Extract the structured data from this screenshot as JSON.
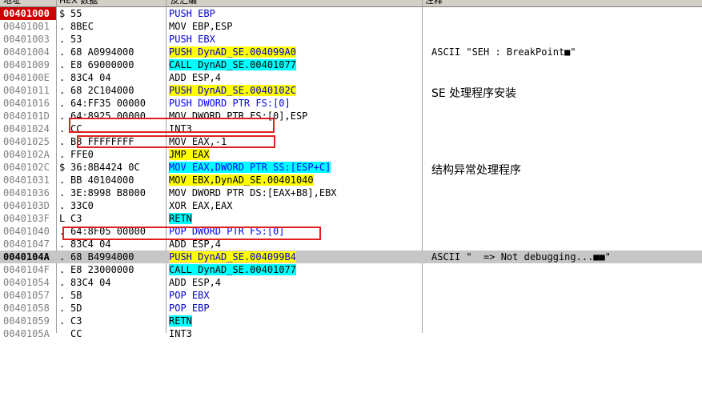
{
  "header": {
    "col_address": "地址",
    "col_hex": "HEX 数据",
    "col_disasm": "反汇编",
    "col_comment": "注释"
  },
  "rows": [
    {
      "addr": "00401000",
      "mark": "$",
      "hex": "55",
      "ins": "PUSH EBP",
      "cmt": ""
    },
    {
      "addr": "00401001",
      "mark": ".",
      "hex": "8BEC",
      "ins": "MOV EBP,ESP",
      "cmt": ""
    },
    {
      "addr": "00401003",
      "mark": ".",
      "hex": "53",
      "ins": "PUSH EBX",
      "cmt": ""
    },
    {
      "addr": "00401004",
      "mark": ".",
      "hex": "68 A0994000",
      "ins": "PUSH DynAD_SE.004099A0",
      "cmt": "ASCII \"SEH : BreakPoint■\""
    },
    {
      "addr": "00401009",
      "mark": ".",
      "hex": "E8 69000000",
      "ins": "CALL DynAD_SE.00401077",
      "cmt": ""
    },
    {
      "addr": "0040100E",
      "mark": ".",
      "hex": "83C4 04",
      "ins": "ADD ESP,4",
      "cmt": ""
    },
    {
      "addr": "00401011",
      "mark": ".",
      "hex": "68 2C104000",
      "ins": "PUSH DynAD_SE.0040102C",
      "cmt": ""
    },
    {
      "addr": "00401016",
      "mark": ".",
      "hex": "64:FF35 00000",
      "ins": "PUSH DWORD PTR FS:[0]",
      "cmt": ""
    },
    {
      "addr": "0040101D",
      "mark": ".",
      "hex": "64:8925 00000",
      "ins": "MOV DWORD PTR FS:[0],ESP",
      "cmt": ""
    },
    {
      "addr": "00401024",
      "mark": ".",
      "hex": "CC",
      "ins": "INT3",
      "cmt": ""
    },
    {
      "addr": "00401025",
      "mark": ".",
      "hex": "B8 FFFFFFFF",
      "ins": "MOV EAX,-1",
      "cmt": ""
    },
    {
      "addr": "0040102A",
      "mark": ".",
      "hex": "FFE0",
      "ins": "JMP EAX",
      "cmt": ""
    },
    {
      "addr": "0040102C",
      "mark": "$",
      "hex": "36:8B4424 0C",
      "ins": "MOV EAX,DWORD PTR SS:[ESP+C]",
      "cmt": ""
    },
    {
      "addr": "00401031",
      "mark": ".",
      "hex": "BB 40104000",
      "ins": "MOV EBX,DynAD_SE.00401040",
      "cmt": ""
    },
    {
      "addr": "00401036",
      "mark": ".",
      "hex": "3E:8998 B8000",
      "ins": "MOV DWORD PTR DS:[EAX+B8],EBX",
      "cmt": ""
    },
    {
      "addr": "0040103D",
      "mark": ".",
      "hex": "33C0",
      "ins": "XOR EAX,EAX",
      "cmt": ""
    },
    {
      "addr": "0040103F",
      "mark": "L",
      "hex": "C3",
      "ins": "RETN",
      "cmt": ""
    },
    {
      "addr": "00401040",
      "mark": ".",
      "hex": "64:8F05 00000",
      "ins": "POP DWORD PTR FS:[0]",
      "cmt": ""
    },
    {
      "addr": "00401047",
      "mark": ".",
      "hex": "83C4 04",
      "ins": "ADD ESP,4",
      "cmt": ""
    },
    {
      "addr": "0040104A",
      "mark": ".",
      "hex": "68 B4994000",
      "ins": "PUSH DynAD_SE.004099B4",
      "cmt": "ASCII \"  => Not debugging...■■\""
    },
    {
      "addr": "0040104F",
      "mark": ".",
      "hex": "E8 23000000",
      "ins": "CALL DynAD_SE.00401077",
      "cmt": ""
    },
    {
      "addr": "00401054",
      "mark": ".",
      "hex": "83C4 04",
      "ins": "ADD ESP,4",
      "cmt": ""
    },
    {
      "addr": "00401057",
      "mark": ".",
      "hex": "5B",
      "ins": "POP EBX",
      "cmt": ""
    },
    {
      "addr": "00401058",
      "mark": ".",
      "hex": "5D",
      "ins": "POP EBP",
      "cmt": ""
    },
    {
      "addr": "00401059",
      "mark": ".",
      "hex": "C3",
      "ins": "RETN",
      "cmt": ""
    },
    {
      "addr": "0040105A",
      "mark": "",
      "hex": "CC",
      "ins": "INT3",
      "cmt": ""
    }
  ],
  "annotations": {
    "seh_install": "SE 处理程序安装",
    "seh_handler": "结构异常处理程序"
  }
}
